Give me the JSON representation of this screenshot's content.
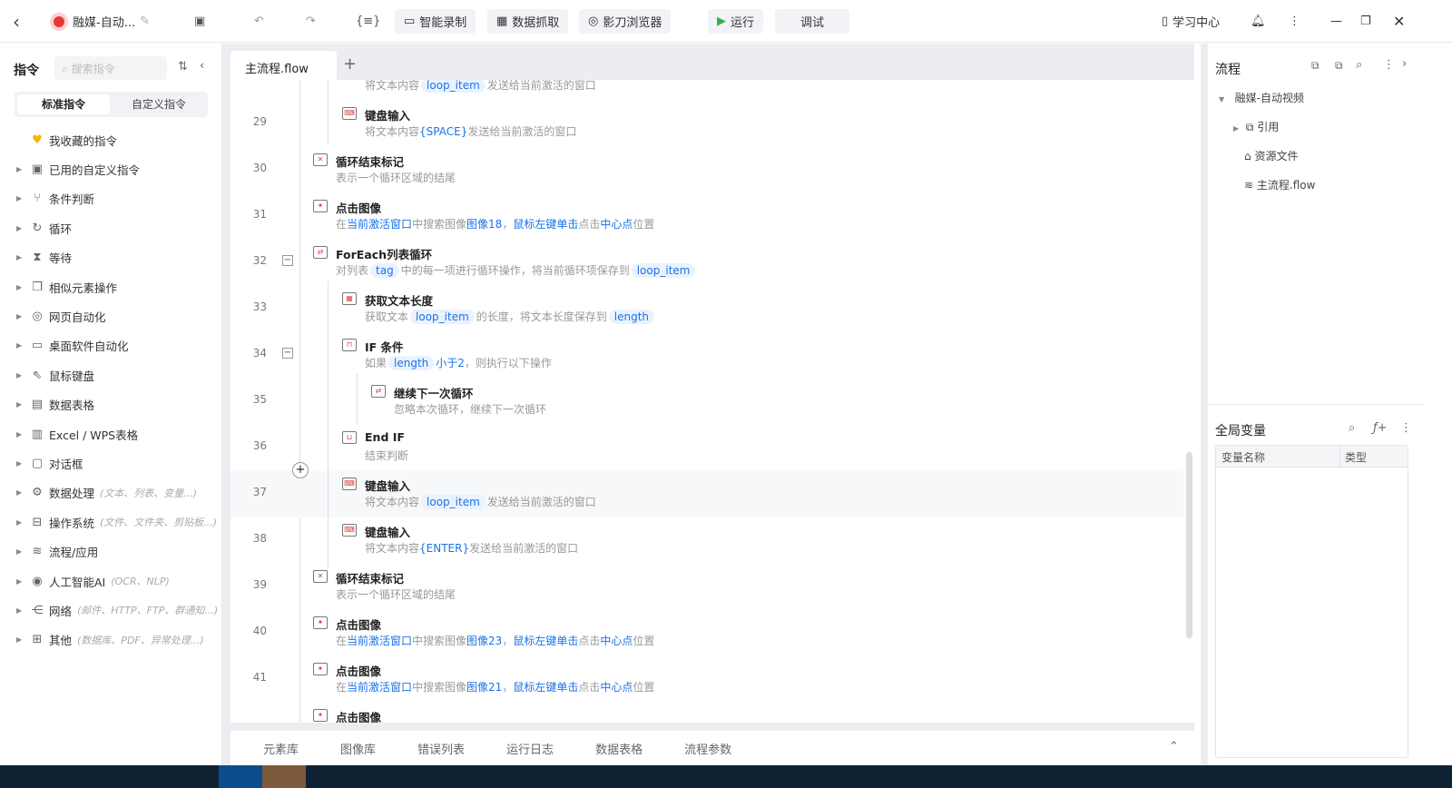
{
  "topbar": {
    "back": "‹",
    "project_name": "融媒-自动...",
    "record": "智能录制",
    "scrape": "数据抓取",
    "browser": "影刀浏览器",
    "run": "运行",
    "debug": "调试",
    "learn": "学习中心"
  },
  "left": {
    "title": "指令",
    "search_placeholder": "搜索指令",
    "tab_standard": "标准指令",
    "tab_custom": "自定义指令",
    "items": [
      {
        "label": "我收藏的指令",
        "icon": "heart-icon",
        "glyph": "♥",
        "hint": "",
        "arrow": false
      },
      {
        "label": "已用的自定义指令",
        "icon": "calendar-icon",
        "glyph": "▣",
        "hint": ""
      },
      {
        "label": "条件判断",
        "icon": "branch-icon",
        "glyph": "⑂",
        "hint": ""
      },
      {
        "label": "循环",
        "icon": "loop-icon",
        "glyph": "↻",
        "hint": ""
      },
      {
        "label": "等待",
        "icon": "hourglass-icon",
        "glyph": "⧗",
        "hint": ""
      },
      {
        "label": "相似元素操作",
        "icon": "copy-icon",
        "glyph": "❐",
        "hint": ""
      },
      {
        "label": "网页自动化",
        "icon": "browser-icon",
        "glyph": "◎",
        "hint": ""
      },
      {
        "label": "桌面软件自动化",
        "icon": "monitor-icon",
        "glyph": "▭",
        "hint": ""
      },
      {
        "label": "鼠标键盘",
        "icon": "cursor-icon",
        "glyph": "⇖",
        "hint": ""
      },
      {
        "label": "数据表格",
        "icon": "document-icon",
        "glyph": "▤",
        "hint": ""
      },
      {
        "label": "Excel / WPS表格",
        "icon": "excel-icon",
        "glyph": "▥",
        "hint": ""
      },
      {
        "label": "对话框",
        "icon": "dialog-icon",
        "glyph": "▢",
        "hint": ""
      },
      {
        "label": "数据处理",
        "icon": "data-process-icon",
        "glyph": "⚙",
        "hint": "(文本、列表、变量...)"
      },
      {
        "label": "操作系统",
        "icon": "briefcase-icon",
        "glyph": "⊟",
        "hint": "(文件、文件夹、剪贴板...)"
      },
      {
        "label": "流程/应用",
        "icon": "layers-icon",
        "glyph": "≋",
        "hint": ""
      },
      {
        "label": "人工智能AI",
        "icon": "ai-icon",
        "glyph": "◉",
        "hint": "(OCR、NLP)"
      },
      {
        "label": "网络",
        "icon": "share-icon",
        "glyph": "⋲",
        "hint": "(邮件、HTTP、FTP、群通知...)"
      },
      {
        "label": "其他",
        "icon": "grid-icon",
        "glyph": "⊞",
        "hint": "(数据库、PDF、异常处理...)"
      }
    ]
  },
  "editor": {
    "tab": "主流程.flow",
    "add_tab": "+",
    "rows": [
      {
        "n": "",
        "lv": 1,
        "icon": "keyboard-icon",
        "g": "⌨",
        "title": "键盘输入",
        "desc": [
          [
            "将文本内容",
            "t"
          ],
          [
            "loop_item",
            "v"
          ],
          [
            "发送给当前激活的窗口",
            "t"
          ]
        ]
      },
      {
        "n": "29",
        "lv": 1,
        "icon": "keyboard-icon",
        "g": "⌨",
        "title": "键盘输入",
        "desc": [
          [
            "将文本内容",
            "t"
          ],
          [
            "{SPACE}",
            "l"
          ],
          [
            "发送给当前激活的窗口",
            "t"
          ]
        ]
      },
      {
        "n": "30",
        "lv": 0,
        "icon": "loop-end-icon",
        "g": "✕",
        "title": "循环结束标记",
        "desc": [
          [
            "表示一个循环区域的结尾",
            "t"
          ]
        ]
      },
      {
        "n": "31",
        "lv": 0,
        "icon": "click-image-icon",
        "g": "✦",
        "title": "点击图像",
        "desc": [
          [
            "在",
            "t"
          ],
          [
            "当前激活窗口",
            "l"
          ],
          [
            "中搜索图像",
            "t"
          ],
          [
            "图像18",
            "l"
          ],
          [
            "，",
            "t"
          ],
          [
            "鼠标左键单击",
            "l"
          ],
          [
            "点击",
            "t"
          ],
          [
            "中心点",
            "l"
          ],
          [
            "位置",
            "t"
          ]
        ]
      },
      {
        "n": "32",
        "lv": 0,
        "fold": true,
        "icon": "foreach-icon",
        "g": "⇄",
        "title": "ForEach列表循环",
        "desc": [
          [
            "对列表",
            "t"
          ],
          [
            "tag",
            "v"
          ],
          [
            "中的每一项进行循环操作，将当前循环项保存到",
            "t"
          ],
          [
            "loop_item",
            "v"
          ]
        ]
      },
      {
        "n": "33",
        "lv": 1,
        "icon": "text-length-icon",
        "g": "▦",
        "title": "获取文本长度",
        "desc": [
          [
            "获取文本",
            "t"
          ],
          [
            "loop_item",
            "v"
          ],
          [
            "的长度，将文本长度保存到",
            "t"
          ],
          [
            "length",
            "v"
          ]
        ]
      },
      {
        "n": "34",
        "lv": 1,
        "fold": true,
        "icon": "if-icon",
        "g": "⊓",
        "title": "IF 条件",
        "desc": [
          [
            "如果",
            "t"
          ],
          [
            "length",
            "v"
          ],
          [
            "小于2",
            "l"
          ],
          [
            "，则执行以下操作",
            "t"
          ]
        ]
      },
      {
        "n": "35",
        "lv": 2,
        "icon": "continue-icon",
        "g": "⇄",
        "title": "继续下一次循环",
        "desc": [
          [
            "忽略本次循环，继续下一次循环",
            "t"
          ]
        ]
      },
      {
        "n": "36",
        "lv": 1,
        "icon": "end-if-icon",
        "g": "⊔",
        "title": "End IF",
        "desc": [
          [
            "结束判断",
            "t"
          ]
        ]
      },
      {
        "n": "37",
        "lv": 1,
        "hl": true,
        "icon": "keyboard-icon",
        "g": "⌨",
        "title": "键盘输入",
        "desc": [
          [
            "将文本内容",
            "t"
          ],
          [
            "loop_item",
            "v"
          ],
          [
            "发送给当前激活的窗口",
            "t"
          ]
        ]
      },
      {
        "n": "38",
        "lv": 1,
        "icon": "keyboard-icon",
        "g": "⌨",
        "title": "键盘输入",
        "desc": [
          [
            "将文本内容",
            "t"
          ],
          [
            "{ENTER}",
            "l"
          ],
          [
            "发送给当前激活的窗口",
            "t"
          ]
        ]
      },
      {
        "n": "39",
        "lv": 0,
        "icon": "loop-end-icon",
        "g": "✕",
        "title": "循环结束标记",
        "desc": [
          [
            "表示一个循环区域的结尾",
            "t"
          ]
        ]
      },
      {
        "n": "40",
        "lv": 0,
        "icon": "click-image-icon",
        "g": "✦",
        "title": "点击图像",
        "desc": [
          [
            "在",
            "t"
          ],
          [
            "当前激活窗口",
            "l"
          ],
          [
            "中搜索图像",
            "t"
          ],
          [
            "图像23",
            "l"
          ],
          [
            "，",
            "t"
          ],
          [
            "鼠标左键单击",
            "l"
          ],
          [
            "点击",
            "t"
          ],
          [
            "中心点",
            "l"
          ],
          [
            "位置",
            "t"
          ]
        ]
      },
      {
        "n": "41",
        "lv": 0,
        "icon": "click-image-icon",
        "g": "✦",
        "title": "点击图像",
        "desc": [
          [
            "在",
            "t"
          ],
          [
            "当前激活窗口",
            "l"
          ],
          [
            "中搜索图像",
            "t"
          ],
          [
            "图像21",
            "l"
          ],
          [
            "，",
            "t"
          ],
          [
            "鼠标左键单击",
            "l"
          ],
          [
            "点击",
            "t"
          ],
          [
            "中心点",
            "l"
          ],
          [
            "位置",
            "t"
          ]
        ]
      },
      {
        "n": "",
        "lv": 0,
        "icon": "click-image-icon",
        "g": "✦",
        "title": "点击图像",
        "desc": []
      }
    ]
  },
  "bottom_tabs": [
    "元素库",
    "图像库",
    "错误列表",
    "运行日志",
    "数据表格",
    "流程参数"
  ],
  "right": {
    "title": "流程",
    "tree_root": "融媒-自动视频",
    "tree_ref": "引用",
    "tree_res": "资源文件",
    "tree_main": "主流程.flow",
    "vars_title": "全局变量",
    "col_name": "变量名称",
    "col_type": "类型"
  }
}
